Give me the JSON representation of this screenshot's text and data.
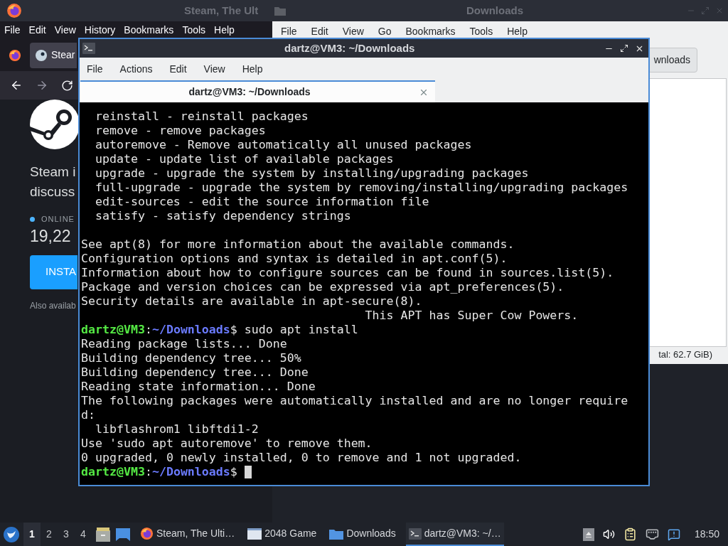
{
  "firefox": {
    "title": "Steam, The Ult",
    "menu": [
      "File",
      "Edit",
      "View",
      "History",
      "Bookmarks",
      "Tools",
      "Help"
    ],
    "tab": {
      "label": "Stear",
      "selected": true
    },
    "page": {
      "tagline": [
        "Steam i",
        "discuss"
      ],
      "online_label": "ONLINE",
      "online_count": "19,22",
      "install_button": "INSTA",
      "also": "Also availab"
    }
  },
  "file_manager": {
    "title": "Downloads",
    "menu": [
      "File",
      "Edit",
      "View",
      "Go",
      "Bookmarks",
      "Tools",
      "Help"
    ],
    "path_button": "wnloads",
    "status": "tal: 62.7 GiB)"
  },
  "terminal": {
    "title": "dartz@VM3: ~/Downloads",
    "menu": [
      "File",
      "Actions",
      "Edit",
      "View",
      "Help"
    ],
    "tab": {
      "label": "dartz@VM3: ~/Downloads",
      "selected": true
    },
    "lines": [
      {
        "kind": "output",
        "text": "  reinstall - reinstall packages"
      },
      {
        "kind": "output",
        "text": "  remove - remove packages"
      },
      {
        "kind": "output",
        "text": "  autoremove - Remove automatically all unused packages"
      },
      {
        "kind": "output",
        "text": "  update - update list of available packages"
      },
      {
        "kind": "output",
        "text": "  upgrade - upgrade the system by installing/upgrading packages"
      },
      {
        "kind": "output",
        "text": "  full-upgrade - upgrade the system by removing/installing/upgrading packages"
      },
      {
        "kind": "output",
        "text": "  edit-sources - edit the source information file"
      },
      {
        "kind": "output",
        "text": "  satisfy - satisfy dependency strings"
      },
      {
        "kind": "blank"
      },
      {
        "kind": "output",
        "text": "See apt(8) for more information about the available commands."
      },
      {
        "kind": "output",
        "text": "Configuration options and syntax is detailed in apt.conf(5)."
      },
      {
        "kind": "output",
        "text": "Information about how to configure sources can be found in sources.list(5)."
      },
      {
        "kind": "output",
        "text": "Package and version choices can be expressed via apt_preferences(5)."
      },
      {
        "kind": "output",
        "text": "Security details are available in apt-secure(8)."
      },
      {
        "kind": "output",
        "text": "                                        This APT has Super Cow Powers."
      },
      {
        "kind": "prompt",
        "user_host": "dartz@VM3",
        "separator": ":",
        "path": "~/Downloads",
        "command": "$ sudo apt install",
        "cursor": false
      },
      {
        "kind": "output",
        "text": "Reading package lists... Done"
      },
      {
        "kind": "output",
        "text": "Building dependency tree... 50%"
      },
      {
        "kind": "output",
        "text": "Building dependency tree... Done"
      },
      {
        "kind": "output",
        "text": "Reading state information... Done"
      },
      {
        "kind": "output",
        "text": "The following packages were automatically installed and are no longer require"
      },
      {
        "kind": "output",
        "text": "d:"
      },
      {
        "kind": "output",
        "text": "  libflashrom1 libftdi1-2"
      },
      {
        "kind": "output",
        "text": "Use 'sudo apt autoremove' to remove them."
      },
      {
        "kind": "output",
        "text": "0 upgraded, 0 newly installed, 0 to remove and 1 not upgraded."
      },
      {
        "kind": "prompt",
        "user_host": "dartz@VM3",
        "separator": ":",
        "path": "~/Downloads",
        "command": "$ ",
        "cursor": true
      }
    ]
  },
  "taskbar": {
    "workspaces": [
      {
        "label": "1",
        "selected": true
      },
      {
        "label": "2",
        "selected": false
      },
      {
        "label": "3",
        "selected": false
      },
      {
        "label": "4",
        "selected": false
      }
    ],
    "tasks": [
      {
        "kind": "browser",
        "label": "Steam, The Ulti…",
        "selected": false
      },
      {
        "kind": "window",
        "label": "2048 Game",
        "selected": false
      },
      {
        "kind": "folder",
        "label": "Downloads",
        "selected": false
      },
      {
        "kind": "terminal",
        "label": "dartz@VM3: ~/…",
        "selected": true
      }
    ],
    "clock": "18:50"
  }
}
